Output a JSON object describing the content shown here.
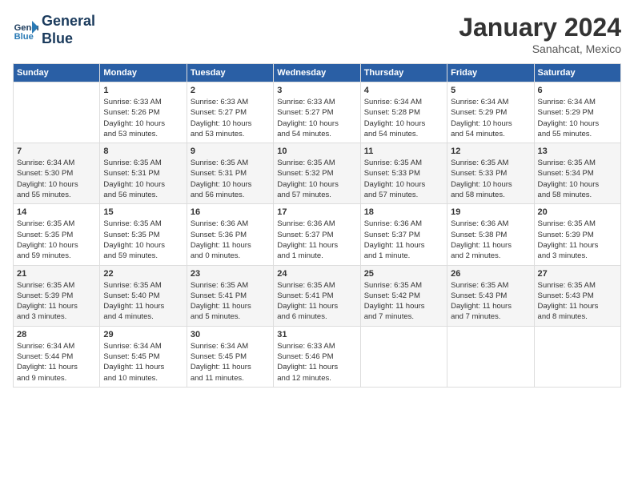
{
  "header": {
    "logo_line1": "General",
    "logo_line2": "Blue",
    "month_title": "January 2024",
    "subtitle": "Sanahcat, Mexico"
  },
  "days_of_week": [
    "Sunday",
    "Monday",
    "Tuesday",
    "Wednesday",
    "Thursday",
    "Friday",
    "Saturday"
  ],
  "weeks": [
    [
      {
        "day": "",
        "info": ""
      },
      {
        "day": "1",
        "info": "Sunrise: 6:33 AM\nSunset: 5:26 PM\nDaylight: 10 hours\nand 53 minutes."
      },
      {
        "day": "2",
        "info": "Sunrise: 6:33 AM\nSunset: 5:27 PM\nDaylight: 10 hours\nand 53 minutes."
      },
      {
        "day": "3",
        "info": "Sunrise: 6:33 AM\nSunset: 5:27 PM\nDaylight: 10 hours\nand 54 minutes."
      },
      {
        "day": "4",
        "info": "Sunrise: 6:34 AM\nSunset: 5:28 PM\nDaylight: 10 hours\nand 54 minutes."
      },
      {
        "day": "5",
        "info": "Sunrise: 6:34 AM\nSunset: 5:29 PM\nDaylight: 10 hours\nand 54 minutes."
      },
      {
        "day": "6",
        "info": "Sunrise: 6:34 AM\nSunset: 5:29 PM\nDaylight: 10 hours\nand 55 minutes."
      }
    ],
    [
      {
        "day": "7",
        "info": "Sunrise: 6:34 AM\nSunset: 5:30 PM\nDaylight: 10 hours\nand 55 minutes."
      },
      {
        "day": "8",
        "info": "Sunrise: 6:35 AM\nSunset: 5:31 PM\nDaylight: 10 hours\nand 56 minutes."
      },
      {
        "day": "9",
        "info": "Sunrise: 6:35 AM\nSunset: 5:31 PM\nDaylight: 10 hours\nand 56 minutes."
      },
      {
        "day": "10",
        "info": "Sunrise: 6:35 AM\nSunset: 5:32 PM\nDaylight: 10 hours\nand 57 minutes."
      },
      {
        "day": "11",
        "info": "Sunrise: 6:35 AM\nSunset: 5:33 PM\nDaylight: 10 hours\nand 57 minutes."
      },
      {
        "day": "12",
        "info": "Sunrise: 6:35 AM\nSunset: 5:33 PM\nDaylight: 10 hours\nand 58 minutes."
      },
      {
        "day": "13",
        "info": "Sunrise: 6:35 AM\nSunset: 5:34 PM\nDaylight: 10 hours\nand 58 minutes."
      }
    ],
    [
      {
        "day": "14",
        "info": "Sunrise: 6:35 AM\nSunset: 5:35 PM\nDaylight: 10 hours\nand 59 minutes."
      },
      {
        "day": "15",
        "info": "Sunrise: 6:35 AM\nSunset: 5:35 PM\nDaylight: 10 hours\nand 59 minutes."
      },
      {
        "day": "16",
        "info": "Sunrise: 6:36 AM\nSunset: 5:36 PM\nDaylight: 11 hours\nand 0 minutes."
      },
      {
        "day": "17",
        "info": "Sunrise: 6:36 AM\nSunset: 5:37 PM\nDaylight: 11 hours\nand 1 minute."
      },
      {
        "day": "18",
        "info": "Sunrise: 6:36 AM\nSunset: 5:37 PM\nDaylight: 11 hours\nand 1 minute."
      },
      {
        "day": "19",
        "info": "Sunrise: 6:36 AM\nSunset: 5:38 PM\nDaylight: 11 hours\nand 2 minutes."
      },
      {
        "day": "20",
        "info": "Sunrise: 6:35 AM\nSunset: 5:39 PM\nDaylight: 11 hours\nand 3 minutes."
      }
    ],
    [
      {
        "day": "21",
        "info": "Sunrise: 6:35 AM\nSunset: 5:39 PM\nDaylight: 11 hours\nand 3 minutes."
      },
      {
        "day": "22",
        "info": "Sunrise: 6:35 AM\nSunset: 5:40 PM\nDaylight: 11 hours\nand 4 minutes."
      },
      {
        "day": "23",
        "info": "Sunrise: 6:35 AM\nSunset: 5:41 PM\nDaylight: 11 hours\nand 5 minutes."
      },
      {
        "day": "24",
        "info": "Sunrise: 6:35 AM\nSunset: 5:41 PM\nDaylight: 11 hours\nand 6 minutes."
      },
      {
        "day": "25",
        "info": "Sunrise: 6:35 AM\nSunset: 5:42 PM\nDaylight: 11 hours\nand 7 minutes."
      },
      {
        "day": "26",
        "info": "Sunrise: 6:35 AM\nSunset: 5:43 PM\nDaylight: 11 hours\nand 7 minutes."
      },
      {
        "day": "27",
        "info": "Sunrise: 6:35 AM\nSunset: 5:43 PM\nDaylight: 11 hours\nand 8 minutes."
      }
    ],
    [
      {
        "day": "28",
        "info": "Sunrise: 6:34 AM\nSunset: 5:44 PM\nDaylight: 11 hours\nand 9 minutes."
      },
      {
        "day": "29",
        "info": "Sunrise: 6:34 AM\nSunset: 5:45 PM\nDaylight: 11 hours\nand 10 minutes."
      },
      {
        "day": "30",
        "info": "Sunrise: 6:34 AM\nSunset: 5:45 PM\nDaylight: 11 hours\nand 11 minutes."
      },
      {
        "day": "31",
        "info": "Sunrise: 6:33 AM\nSunset: 5:46 PM\nDaylight: 11 hours\nand 12 minutes."
      },
      {
        "day": "",
        "info": ""
      },
      {
        "day": "",
        "info": ""
      },
      {
        "day": "",
        "info": ""
      }
    ]
  ]
}
